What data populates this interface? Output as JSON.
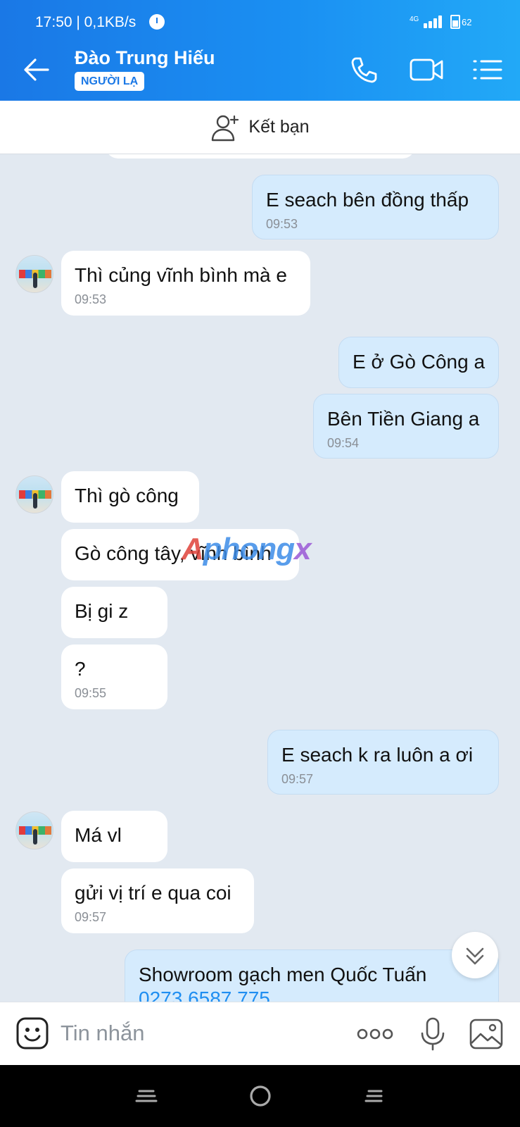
{
  "status_bar": {
    "time": "17:50 | 0,1KB/s",
    "network": "4G",
    "battery": "62",
    "signal_level": 4
  },
  "header": {
    "contact_name": "Đào Trung Hiếu",
    "badge": "NGƯỜI LẠ",
    "icons": [
      "back-arrow-icon",
      "phone-icon",
      "video-call-icon",
      "menu-list-icon"
    ]
  },
  "add_friend": {
    "label": "Kết bạn",
    "icon": "add-user-icon"
  },
  "messages": [
    {
      "dir": "out",
      "text": "E seach bên đồng thấp",
      "time": "09:53"
    },
    {
      "dir": "in",
      "text": "Thì củng vĩnh bình mà e",
      "time": "09:53"
    },
    {
      "dir": "out",
      "text": "E ở Gò Công a",
      "time": ""
    },
    {
      "dir": "out",
      "text": "Bên Tiền Giang a",
      "time": "09:54"
    },
    {
      "dir": "in",
      "text": "Thì gò công",
      "time": ""
    },
    {
      "dir": "in",
      "text": "Gò công tây, vĩnh bình",
      "time": ""
    },
    {
      "dir": "in",
      "text": "Bị gi z",
      "time": ""
    },
    {
      "dir": "in",
      "text": "?",
      "time": "09:55"
    },
    {
      "dir": "out",
      "text": "E seach k ra luôn a ơi",
      "time": "09:57"
    },
    {
      "dir": "in",
      "text": "Má vl",
      "time": ""
    },
    {
      "dir": "in",
      "text": "gửi vị trí e qua coi",
      "time": "09:57"
    },
    {
      "dir": "out",
      "text": "Showroom gạch men Quốc Tuấn",
      "link": "0273 6587 775",
      "time": ""
    }
  ],
  "watermark": {
    "part1": "A",
    "part2": "phong",
    "part3": "x"
  },
  "input_bar": {
    "placeholder": "Tin nhắn",
    "icons": [
      "emoji-icon",
      "more-dots-icon",
      "microphone-icon",
      "image-icon"
    ]
  },
  "colors": {
    "header_start": "#1a78e6",
    "header_end": "#22a9f7",
    "chat_bg": "#e2e9f1",
    "outgoing_bubble": "#d5ebfd",
    "incoming_bubble": "#ffffff",
    "link": "#1f8ef1"
  }
}
